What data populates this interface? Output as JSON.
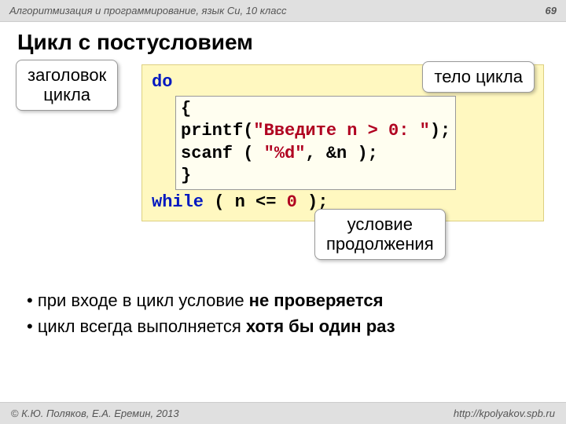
{
  "header": {
    "course": "Алгоритмизация и программирование, язык Си, 10 класс",
    "page": "69"
  },
  "title": "Цикл с постусловием",
  "callouts": {
    "loop_header_l1": "заголовок",
    "loop_header_l2": "цикла",
    "loop_body": "тело цикла",
    "cond_l1": "условие",
    "cond_l2": "продолжения"
  },
  "code": {
    "do": "do",
    "open": "{",
    "printf_a": "printf(",
    "printf_str": "\"Введите n > 0: \"",
    "printf_b": ");",
    "scanf_a": "scanf ( ",
    "scanf_str": "\"%d\"",
    "scanf_b": ", &n );",
    "close": "}",
    "while_a": "while",
    "while_b": " ( n <= ",
    "while_c": "0",
    "while_d": " );"
  },
  "bullets": {
    "b1_a": "при входе в цикл условие ",
    "b1_b": "не проверяется",
    "b2_a": "цикл всегда выполняется ",
    "b2_b": "хотя бы один раз"
  },
  "footer": {
    "copy_symbol": "©",
    "authors": " К.Ю. Поляков, Е.А. Еремин, 2013",
    "url": "http://kpolyakov.spb.ru"
  }
}
